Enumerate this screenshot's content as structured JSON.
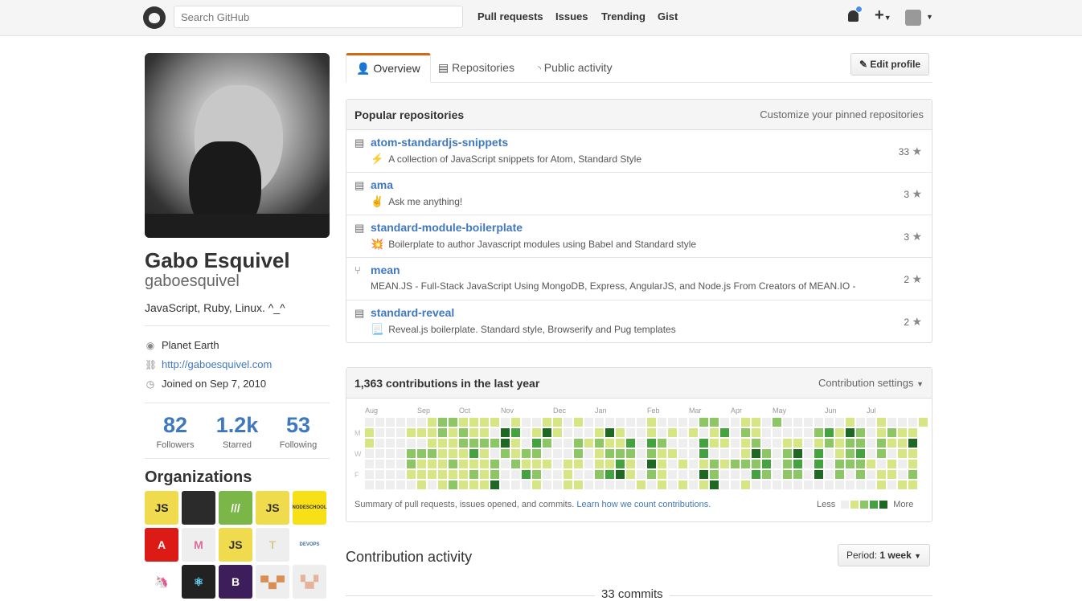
{
  "header": {
    "search_placeholder": "Search GitHub",
    "nav": [
      "Pull requests",
      "Issues",
      "Trending",
      "Gist"
    ]
  },
  "profile": {
    "name": "Gabo Esquivel",
    "login": "gaboesquivel",
    "bio": "JavaScript, Ruby, Linux. ^_^",
    "location": "Planet Earth",
    "website": "http://gaboesquivel.com",
    "joined": "Joined on Sep 7, 2010",
    "stats": [
      {
        "value": "82",
        "label": "Followers"
      },
      {
        "value": "1.2k",
        "label": "Starred"
      },
      {
        "value": "53",
        "label": "Following"
      }
    ]
  },
  "organizations": {
    "title": "Organizations",
    "items": [
      {
        "label": "JS",
        "bg": "#f0db4f",
        "fg": "#222"
      },
      {
        "label": "",
        "bg": "#2b2b2b",
        "fg": "#6ab0de"
      },
      {
        "label": "///",
        "bg": "#7ab648",
        "fg": "#fff"
      },
      {
        "label": "JS",
        "bg": "#f0db4f",
        "fg": "#333"
      },
      {
        "label": "NODESCHOOL",
        "bg": "#f7e018",
        "fg": "#333"
      },
      {
        "label": "A",
        "bg": "#dd1b16",
        "fg": "#fff"
      },
      {
        "label": "M",
        "bg": "#eee",
        "fg": "#d96d9c"
      },
      {
        "label": "JS",
        "bg": "#f0db4f",
        "fg": "#333"
      },
      {
        "label": "T",
        "bg": "#eee",
        "fg": "#d4c98a"
      },
      {
        "label": "DEVOPS",
        "bg": "#fff",
        "fg": "#3a6ea5"
      },
      {
        "label": "🦄",
        "bg": "#fff",
        "fg": "#000"
      },
      {
        "label": "⚛",
        "bg": "#222",
        "fg": "#61dafb"
      },
      {
        "label": "B",
        "bg": "#3d1e5a",
        "fg": "#fff"
      },
      {
        "label": "▀▄▀",
        "bg": "#eee",
        "fg": "#d98e55"
      },
      {
        "label": "▚▞",
        "bg": "#eee",
        "fg": "#e4b39a"
      }
    ]
  },
  "tabs": [
    {
      "label": "Overview",
      "icon": "person-icon"
    },
    {
      "label": "Repositories",
      "icon": "repo-icon"
    },
    {
      "label": "Public activity",
      "icon": "rss-icon"
    }
  ],
  "edit_profile": "Edit profile",
  "popular": {
    "title": "Popular repositories",
    "customize": "Customize your pinned repositories",
    "repos": [
      {
        "name": "atom-standardjs-snippets",
        "emoji": "⚡",
        "desc": "A collection of JavaScript snippets for Atom, Standard Style",
        "stars": "33",
        "fork": false
      },
      {
        "name": "ama",
        "emoji": "✌",
        "desc": "Ask me anything!",
        "stars": "3",
        "fork": false
      },
      {
        "name": "standard-module-boilerplate",
        "emoji": "💥",
        "desc": "Boilerplate to author Javascript modules using Babel and Standard style",
        "stars": "3",
        "fork": false
      },
      {
        "name": "mean",
        "emoji": "",
        "desc": "MEAN.JS - Full-Stack JavaScript Using MongoDB, Express, AngularJS, and Node.js From Creators of MEAN.IO -",
        "stars": "2",
        "fork": true
      },
      {
        "name": "standard-reveal",
        "emoji": "📃",
        "desc": "Reveal.js boilerplate. Standard style, Browserify and Pug templates",
        "stars": "2",
        "fork": false
      }
    ]
  },
  "contrib": {
    "title": "1,363 contributions in the last year",
    "settings": "Contribution settings",
    "summary": "Summary of pull requests, issues opened, and commits.",
    "learn": "Learn how we count contributions.",
    "less": "Less",
    "more": "More",
    "day_labels": [
      "M",
      "W",
      "F"
    ]
  },
  "chart_data": {
    "type": "heatmap",
    "colors": [
      "#eeeeee",
      "#d6e685",
      "#8cc665",
      "#44a340",
      "#1e6823"
    ],
    "months": [
      {
        "label": "Aug",
        "week": 0
      },
      {
        "label": "Sep",
        "week": 5
      },
      {
        "label": "Oct",
        "week": 9
      },
      {
        "label": "Nov",
        "week": 13
      },
      {
        "label": "Dec",
        "week": 18
      },
      {
        "label": "Jan",
        "week": 22
      },
      {
        "label": "Feb",
        "week": 27
      },
      {
        "label": "Mar",
        "week": 31
      },
      {
        "label": "Apr",
        "week": 35
      },
      {
        "label": "May",
        "week": 39
      },
      {
        "label": "Jun",
        "week": 44
      },
      {
        "label": "Jul",
        "week": 48
      }
    ],
    "rows_by_weekday_levels": [
      "000000122111101001101000000100002200110200000010010001",
      "10001112121104301410001410010101013021000002314201211",
      "10000011122224103200212113032000311012001101212202114",
      "00002221113102122000201222021100300014202403012302011",
      "00002111211120211101101131041010121222302303022210101",
      "00001111112120032001002341021000420003202204020201102",
      "00000101211140001001100000101010140010000000000001011"
    ]
  },
  "activity": {
    "title": "Contribution activity",
    "period_label": "Period:",
    "period_value": "1 week",
    "commits": "33 commits"
  }
}
